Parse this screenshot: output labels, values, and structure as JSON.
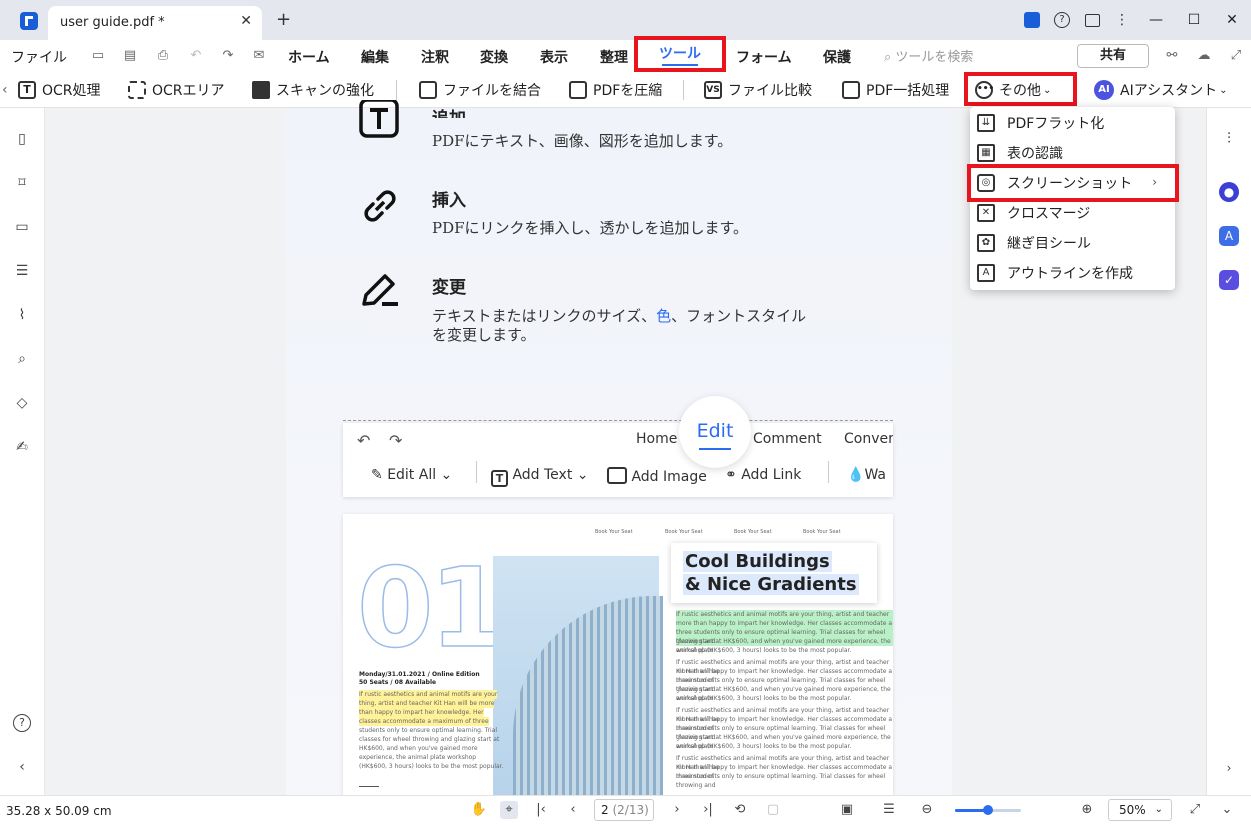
{
  "titlebar": {
    "tab_title": "user guide.pdf *",
    "close_glyph": "✕",
    "new_tab_glyph": "+"
  },
  "menu": {
    "file": "ファイル",
    "home": "ホーム",
    "edit": "編集",
    "annotate": "注釈",
    "convert": "変換",
    "view": "表示",
    "organize": "整理",
    "tools": "ツール",
    "form": "フォーム",
    "protect": "保護",
    "search_placeholder": "ツールを検索",
    "share": "共有"
  },
  "toolbar": {
    "ocr": "OCR処理",
    "ocr_area": "OCRエリア",
    "enhance_scan": "スキャンの強化",
    "combine": "ファイルを結合",
    "compress": "PDFを圧縮",
    "compare": "ファイル比較",
    "batch": "PDF一括処理",
    "more": "その他",
    "ai": "AIアシスタント"
  },
  "dropdown": {
    "items": [
      {
        "label": "PDFフラット化",
        "icon": "flatten-icon"
      },
      {
        "label": "表の認識",
        "icon": "table-recognize-icon"
      },
      {
        "label": "スクリーンショット",
        "icon": "screenshot-icon",
        "has_submenu": true
      },
      {
        "label": "クロスマージ",
        "icon": "cross-merge-icon"
      },
      {
        "label": "継ぎ目シール",
        "icon": "seam-seal-icon"
      },
      {
        "label": "アウトラインを作成",
        "icon": "outline-icon"
      }
    ]
  },
  "page": {
    "feature_add_title": "追加",
    "feature_add_desc": "PDFにテキスト、画像、図形を追加します。",
    "feature_insert_title": "挿入",
    "feature_insert_desc": "PDFにリンクを挿入し、透かしを追加します。",
    "feature_change_title": "変更",
    "feature_change_desc_1": "テキストまたはリンクのサイズ、",
    "feature_change_desc_color": "色",
    "feature_change_desc_2": "、フォントスタイル",
    "feature_change_desc_3": "を変更します。",
    "editbar": {
      "home": "Home",
      "edit": "Edit",
      "comment": "Comment",
      "convert": "Convert",
      "edit_all": "Edit All",
      "add_text": "Add Text",
      "add_image": "Add Image",
      "add_link": "Add Link",
      "watermark": "Wa"
    },
    "magazine": {
      "big_number": "01",
      "header_1": "Book Your Seat",
      "header_2": "Book Your Seat",
      "header_3": "Book Your Seat",
      "header_4": "Book Your Seat",
      "heading_1": "Cool Buildings",
      "heading_2": "& Nice Gradients",
      "date_line": "Monday/31.01.2021 / Online Edition",
      "seats_line": "50 Seats / 08 Available",
      "body_a1": "If rustic aesthetics and animal motifs are your thing, artist and teacher Kit Han will be",
      "body_a2": "more than happy to impart her knowledge. Her classes accommodate a maximum of",
      "body_a3": "three students only to ensure optimal learning. Trial classes for wheel throwing and",
      "body_a4": "glazing start at HK$600, and when you've gained more experience, the animal plate",
      "body_a5": "workshop (HK$600, 3 hours) looks to be the most popular.",
      "left_1": "If rustic aesthetics and animal motifs are your",
      "left_2": "thing, artist and teacher Kit Han will be more",
      "left_3": "than happy to impart her knowledge. Her",
      "left_4": "classes accommodate a maximum of three",
      "left_5": "students only to ensure optimal learning. Trial",
      "left_6": "classes for wheel throwing and glazing start at",
      "left_7": "HK$600, and when you've gained more",
      "left_8": "experience, the animal plate workshop",
      "left_9": "(HK$600, 3 hours) looks to be the most popular."
    }
  },
  "status": {
    "dimensions": "35.28 x 50.09 cm",
    "page_current": "2",
    "page_total": "(2/13)",
    "zoom": "50%",
    "zoom_fraction": 0.5
  }
}
